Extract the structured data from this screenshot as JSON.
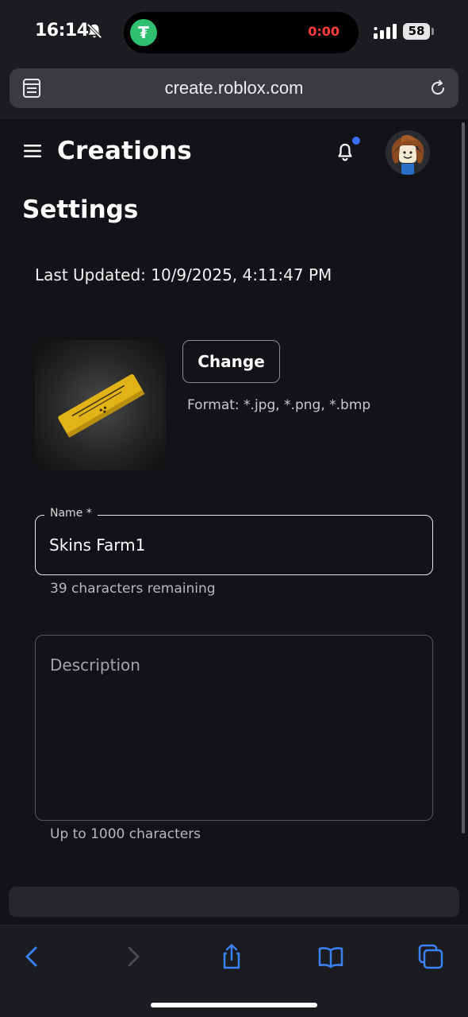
{
  "status_bar": {
    "time": "16:14",
    "recording_timer": "0:00",
    "battery_level": "58",
    "tether_glyph": "₮",
    "icons": [
      "bell-slash-icon",
      "tether-icon",
      "signal-icon",
      "battery-icon"
    ]
  },
  "browser": {
    "url": "create.roblox.com",
    "icons": [
      "tabs-icon",
      "reload-icon",
      "back-icon",
      "forward-icon",
      "share-icon",
      "bookmarks-icon",
      "tabs-overview-icon"
    ],
    "forward_enabled": false
  },
  "header": {
    "title": "Creations",
    "has_unread_notifications": true
  },
  "settings": {
    "title": "Settings",
    "last_updated": "Last Updated: 10/9/2025, 4:11:47 PM",
    "thumbnail": {
      "change_label": "Change",
      "format_hint": "Format: *.jpg, *.png, *.bmp"
    },
    "name_field": {
      "label": "Name *",
      "value": "Skins Farm1",
      "help": "39 characters remaining"
    },
    "description_field": {
      "placeholder": "Description",
      "value": "",
      "help": "Up to 1000 characters"
    }
  },
  "colors": {
    "background": "#121317",
    "accent_blue": "#3a6df5",
    "ios_blue": "#3b82f6",
    "thumbnail_gold": "#e2b317",
    "recording_red": "#ff3b3b"
  }
}
